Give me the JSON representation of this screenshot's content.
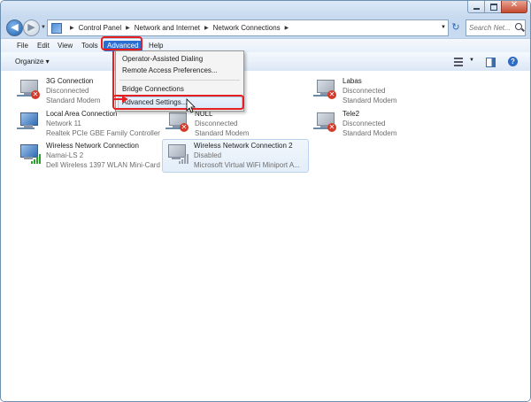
{
  "window": {
    "close_glyph": "✕"
  },
  "nav": {
    "back_glyph": "◀",
    "forward_glyph": "▶",
    "refresh_glyph": "↻"
  },
  "breadcrumbs": [
    "Control Panel",
    "Network and Internet",
    "Network Connections"
  ],
  "search": {
    "placeholder": "Search Net..."
  },
  "menu": {
    "items": [
      "File",
      "Edit",
      "View",
      "Tools",
      "Advanced",
      "Help"
    ],
    "active": "Advanced"
  },
  "toolbar": {
    "organize_label": "Organize ▾",
    "help_glyph": "?"
  },
  "advanced_menu": {
    "items": [
      "Operator-Assisted Dialing",
      "Remote Access Preferences...",
      "Bridge Connections",
      "Advanced Settings..."
    ],
    "highlighted": "Advanced Settings..."
  },
  "connections": [
    {
      "name": "3G Connection",
      "status": "Disconnected",
      "device": "Standard Modem"
    },
    {
      "name": "Labas",
      "status": "Disconnected",
      "device": "Standard Modem"
    },
    {
      "name": "Local Area Connection",
      "status": "Network 11",
      "device": "Realtek PCIe GBE Family Controller"
    },
    {
      "name": "NULL",
      "status": "Disconnected",
      "device": "Standard Modem"
    },
    {
      "name": "Tele2",
      "status": "Disconnected",
      "device": "Standard Modem"
    },
    {
      "name": "Wireless Network Connection",
      "status": "Namai-LS 2",
      "device": "Dell Wireless 1397 WLAN Mini-Card"
    },
    {
      "name": "Wireless Network Connection 2",
      "status": "Disabled",
      "device": "Microsoft Virtual WiFi Miniport A..."
    }
  ],
  "colors": {
    "highlight": "#e51f1f",
    "menu_active": "#2a6ed1"
  }
}
